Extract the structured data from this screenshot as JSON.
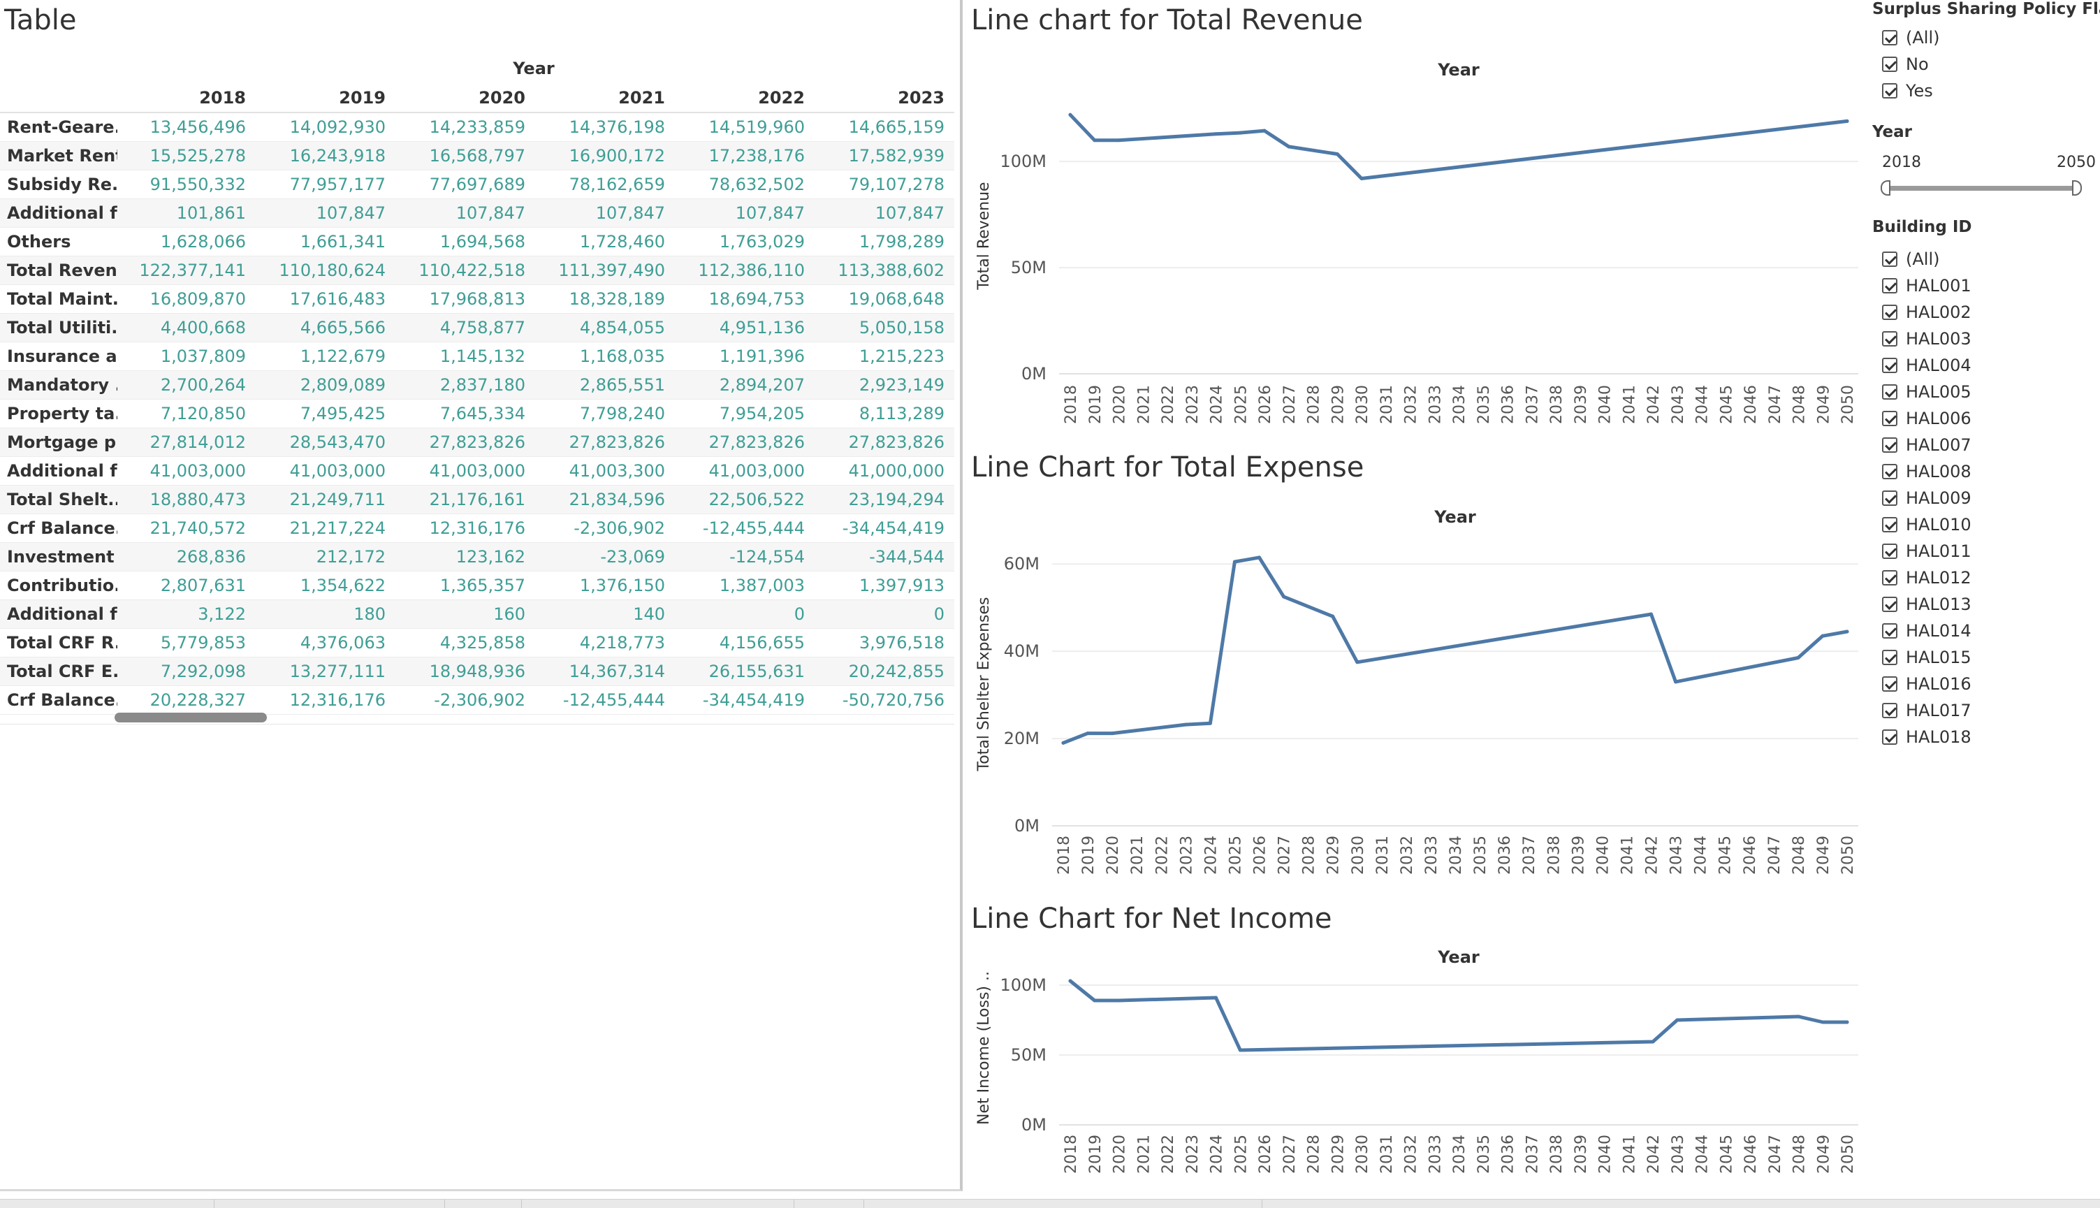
{
  "table": {
    "title": "Table",
    "year_header": "Year",
    "columns": [
      "2018",
      "2019",
      "2020",
      "2021",
      "2022",
      "2023"
    ],
    "rows": [
      {
        "label": "Rent-Geare..",
        "values": [
          "13,456,496",
          "14,092,930",
          "14,233,859",
          "14,376,198",
          "14,519,960",
          "14,665,159"
        ]
      },
      {
        "label": "Market Rent",
        "values": [
          "15,525,278",
          "16,243,918",
          "16,568,797",
          "16,900,172",
          "17,238,176",
          "17,582,939"
        ]
      },
      {
        "label": "Subsidy Re..",
        "values": [
          "91,550,332",
          "77,957,177",
          "77,697,689",
          "78,162,659",
          "78,632,502",
          "79,107,278"
        ]
      },
      {
        "label": "Additional f..",
        "values": [
          "101,861",
          "107,847",
          "107,847",
          "107,847",
          "107,847",
          "107,847"
        ]
      },
      {
        "label": "Others",
        "values": [
          "1,628,066",
          "1,661,341",
          "1,694,568",
          "1,728,460",
          "1,763,029",
          "1,798,289"
        ]
      },
      {
        "label": "Total Reven..",
        "values": [
          "122,377,141",
          "110,180,624",
          "110,422,518",
          "111,397,490",
          "112,386,110",
          "113,388,602"
        ]
      },
      {
        "label": "Total Maint..",
        "values": [
          "16,809,870",
          "17,616,483",
          "17,968,813",
          "18,328,189",
          "18,694,753",
          "19,068,648"
        ]
      },
      {
        "label": "Total Utiliti..",
        "values": [
          "4,400,668",
          "4,665,566",
          "4,758,877",
          "4,854,055",
          "4,951,136",
          "5,050,158"
        ]
      },
      {
        "label": "Insurance a..",
        "values": [
          "1,037,809",
          "1,122,679",
          "1,145,132",
          "1,168,035",
          "1,191,396",
          "1,215,223"
        ]
      },
      {
        "label": "Mandatory ..",
        "values": [
          "2,700,264",
          "2,809,089",
          "2,837,180",
          "2,865,551",
          "2,894,207",
          "2,923,149"
        ]
      },
      {
        "label": "Property ta..",
        "values": [
          "7,120,850",
          "7,495,425",
          "7,645,334",
          "7,798,240",
          "7,954,205",
          "8,113,289"
        ]
      },
      {
        "label": "Mortgage p..",
        "values": [
          "27,814,012",
          "28,543,470",
          "27,823,826",
          "27,823,826",
          "27,823,826",
          "27,823,826"
        ]
      },
      {
        "label": "Additional f..",
        "values": [
          "41,003,000",
          "41,003,000",
          "41,003,000",
          "41,003,300",
          "41,003,000",
          "41,000,000"
        ]
      },
      {
        "label": "Total Shelt..",
        "values": [
          "18,880,473",
          "21,249,711",
          "21,176,161",
          "21,834,596",
          "22,506,522",
          "23,194,294"
        ]
      },
      {
        "label": "Crf Balance..",
        "values": [
          "21,740,572",
          "21,217,224",
          "12,316,176",
          "-2,306,902",
          "-12,455,444",
          "-34,454,419"
        ]
      },
      {
        "label": "Investment ..",
        "values": [
          "268,836",
          "212,172",
          "123,162",
          "-23,069",
          "-124,554",
          "-344,544"
        ]
      },
      {
        "label": "Contributio..",
        "values": [
          "2,807,631",
          "1,354,622",
          "1,365,357",
          "1,376,150",
          "1,387,003",
          "1,397,913"
        ]
      },
      {
        "label": "Additional f..",
        "values": [
          "3,122",
          "180",
          "160",
          "140",
          "0",
          "0"
        ]
      },
      {
        "label": "Total CRF R..",
        "values": [
          "5,779,853",
          "4,376,063",
          "4,325,858",
          "4,218,773",
          "4,156,655",
          "3,976,518"
        ]
      },
      {
        "label": "Total CRF E..",
        "values": [
          "7,292,098",
          "13,277,111",
          "18,948,936",
          "14,367,314",
          "26,155,631",
          "20,242,855"
        ]
      },
      {
        "label": "Crf Balance..",
        "values": [
          "20,228,327",
          "12,316,176",
          "-2,306,902",
          "-12,455,444",
          "-34,454,419",
          "-50,720,756"
        ]
      }
    ]
  },
  "charts": {
    "revenue": {
      "title": "Line chart for Total Revenue"
    },
    "expense": {
      "title": "Line Chart for Total Expense"
    },
    "net_income": {
      "title": "Line Chart for Net Income"
    }
  },
  "chart_data": [
    {
      "id": "revenue",
      "type": "line",
      "title": "Line chart for Total Revenue",
      "xlabel": "Year",
      "ylabel": "Total Revenue",
      "ylim": [
        0,
        130000000
      ],
      "yticks": [
        0,
        50000000,
        100000000
      ],
      "ytick_labels": [
        "0M",
        "50M",
        "100M"
      ],
      "x": [
        2018,
        2019,
        2020,
        2024,
        2025,
        2026,
        2027,
        2029,
        2030,
        2050
      ],
      "y": [
        122000000,
        110000000,
        110000000,
        113000000,
        113500000,
        114500000,
        107000000,
        103500000,
        92000000,
        119000000
      ],
      "color": "#4e79a7"
    },
    {
      "id": "expense",
      "type": "line",
      "title": "Line Chart for Total Expense",
      "xlabel": "Year",
      "ylabel": "Total Shelter Expenses",
      "ylim": [
        0,
        65000000
      ],
      "yticks": [
        0,
        20000000,
        40000000,
        60000000
      ],
      "ytick_labels": [
        "0M",
        "20M",
        "40M",
        "60M"
      ],
      "x": [
        2018,
        2019,
        2020,
        2023,
        2024,
        2025,
        2026,
        2027,
        2029,
        2030,
        2042,
        2043,
        2048,
        2049,
        2050
      ],
      "y": [
        19000000,
        21200000,
        21200000,
        23200000,
        23500000,
        60500000,
        61500000,
        52500000,
        48000000,
        37500000,
        48500000,
        33000000,
        38500000,
        43500000,
        44500000
      ],
      "color": "#4e79a7"
    },
    {
      "id": "net_income",
      "type": "line",
      "title": "Line Chart for Net Income",
      "xlabel": "Year",
      "ylabel": "Net Income (Loss) ..",
      "ylim": [
        0,
        110000000
      ],
      "yticks": [
        0,
        50000000,
        100000000
      ],
      "ytick_labels": [
        "0M",
        "50M",
        "100M"
      ],
      "x": [
        2018,
        2019,
        2020,
        2024,
        2025,
        2042,
        2043,
        2048,
        2049,
        2050
      ],
      "y": [
        103000000,
        89000000,
        89000000,
        91000000,
        53500000,
        59500000,
        75000000,
        77500000,
        73500000,
        73500000
      ],
      "color": "#4e79a7"
    }
  ],
  "filters": {
    "surplus": {
      "title": "Surplus Sharing Policy Flag",
      "options": [
        "(All)",
        "No",
        "Yes"
      ]
    },
    "year": {
      "title": "Year",
      "min": "2018",
      "max": "2050"
    },
    "building": {
      "title": "Building ID",
      "options": [
        "(All)",
        "HAL001",
        "HAL002",
        "HAL003",
        "HAL004",
        "HAL005",
        "HAL006",
        "HAL007",
        "HAL008",
        "HAL009",
        "HAL010",
        "HAL011",
        "HAL012",
        "HAL013",
        "HAL014",
        "HAL015",
        "HAL016",
        "HAL017",
        "HAL018"
      ]
    }
  }
}
